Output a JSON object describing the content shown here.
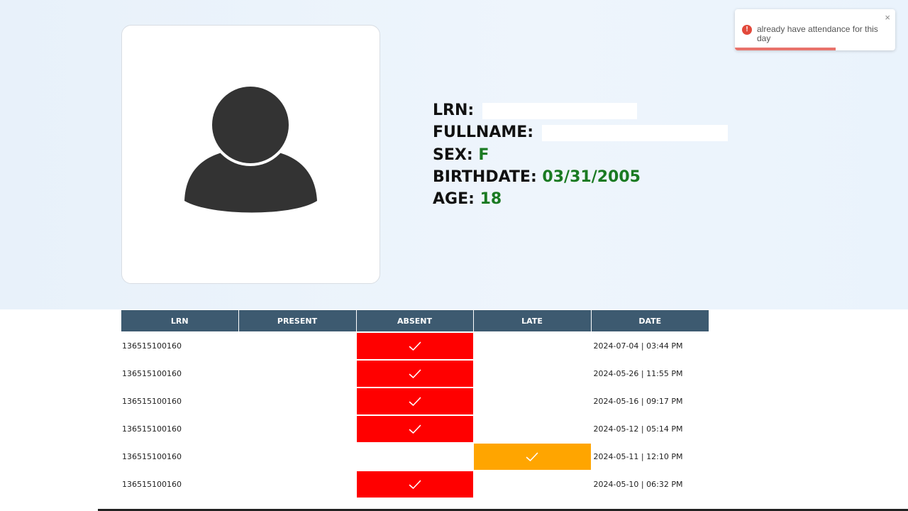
{
  "student": {
    "lrn_label": "LRN:",
    "lrn_value": "",
    "fullname_label": "FULLNAME:",
    "fullname_value": "",
    "sex_label": "SEX:",
    "sex_value": "F",
    "birthdate_label": "BIRTHDATE:",
    "birthdate_value": "03/31/2005",
    "age_label": "AGE:",
    "age_value": "18"
  },
  "table": {
    "headers": [
      "LRN",
      "PRESENT",
      "ABSENT",
      "LATE",
      "DATE"
    ],
    "rows": [
      {
        "lrn": "136515100160",
        "status": "absent",
        "date": "2024-07-04 | 03:44 PM"
      },
      {
        "lrn": "136515100160",
        "status": "absent",
        "date": "2024-05-26 | 11:55 PM"
      },
      {
        "lrn": "136515100160",
        "status": "absent",
        "date": "2024-05-16 | 09:17 PM"
      },
      {
        "lrn": "136515100160",
        "status": "absent",
        "date": "2024-05-12 | 05:14 PM"
      },
      {
        "lrn": "136515100160",
        "status": "late",
        "date": "2024-05-11 | 12:10 PM"
      },
      {
        "lrn": "136515100160",
        "status": "absent",
        "date": "2024-05-10 | 06:32 PM"
      }
    ]
  },
  "toast": {
    "icon": "error-icon",
    "message": "already have attendance for this day",
    "close_symbol": "×",
    "progress": 0.63
  },
  "colors": {
    "absent": "#ff0000",
    "late": "#ffa500",
    "header": "#3d5a70",
    "value_green": "#1a7a22"
  }
}
